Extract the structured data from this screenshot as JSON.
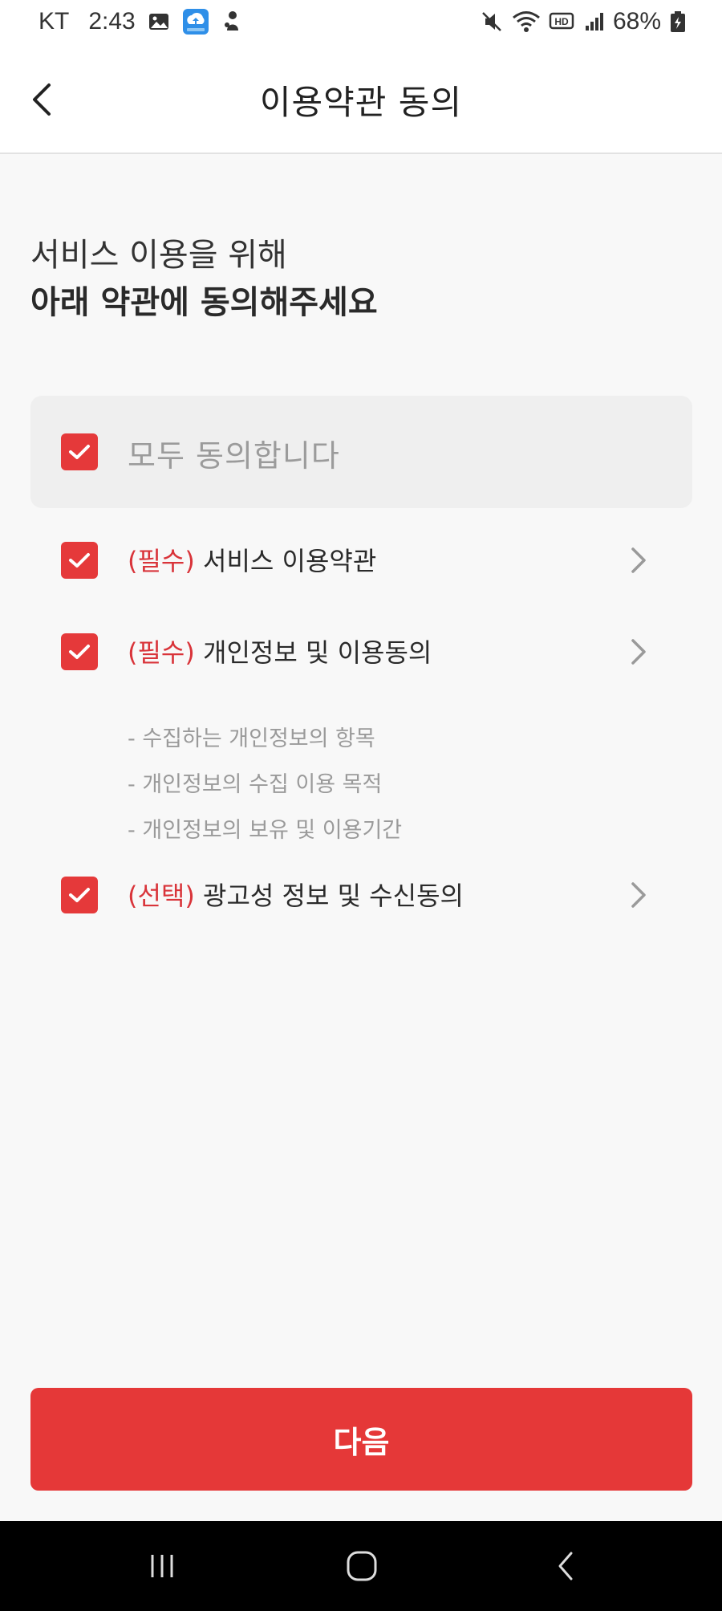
{
  "status_bar": {
    "carrier": "KT",
    "time": "2:43",
    "battery": "68%",
    "left_icons": [
      "gallery-icon",
      "cloud-upload-app-icon",
      "notification-app-icon"
    ],
    "right_icons": [
      "mute-icon",
      "wifi-icon",
      "hd-voice-icon",
      "signal-icon",
      "battery-icon"
    ]
  },
  "header": {
    "title": "이용약관 동의",
    "back_icon": "chevron-left-icon"
  },
  "intro": {
    "line1": "서비스 이용을 위해",
    "line2": "아래 약관에 동의해주세요"
  },
  "agree_all": {
    "label": "모두 동의합니다",
    "checked": true
  },
  "terms": [
    {
      "tag": "(필수)",
      "label": "서비스 이용약관",
      "checked": true
    },
    {
      "tag": "(필수)",
      "label": "개인정보 및 이용동의",
      "checked": true
    },
    {
      "tag": "(선택)",
      "label": "광고성 정보 및 수신동의",
      "checked": true
    }
  ],
  "privacy_details": [
    "- 수집하는 개인정보의 항목",
    "- 개인정보의 수집 이용 목적",
    "- 개인정보의 보유 및 이용기간"
  ],
  "next_button": {
    "label": "다음"
  },
  "colors": {
    "accent": "#e53838",
    "checkbox": "#e5393a",
    "tag_text": "#d9343a",
    "background": "#f8f8f8"
  },
  "nav_bar": {
    "icons": [
      "recent-apps-icon",
      "home-icon",
      "back-icon"
    ]
  }
}
